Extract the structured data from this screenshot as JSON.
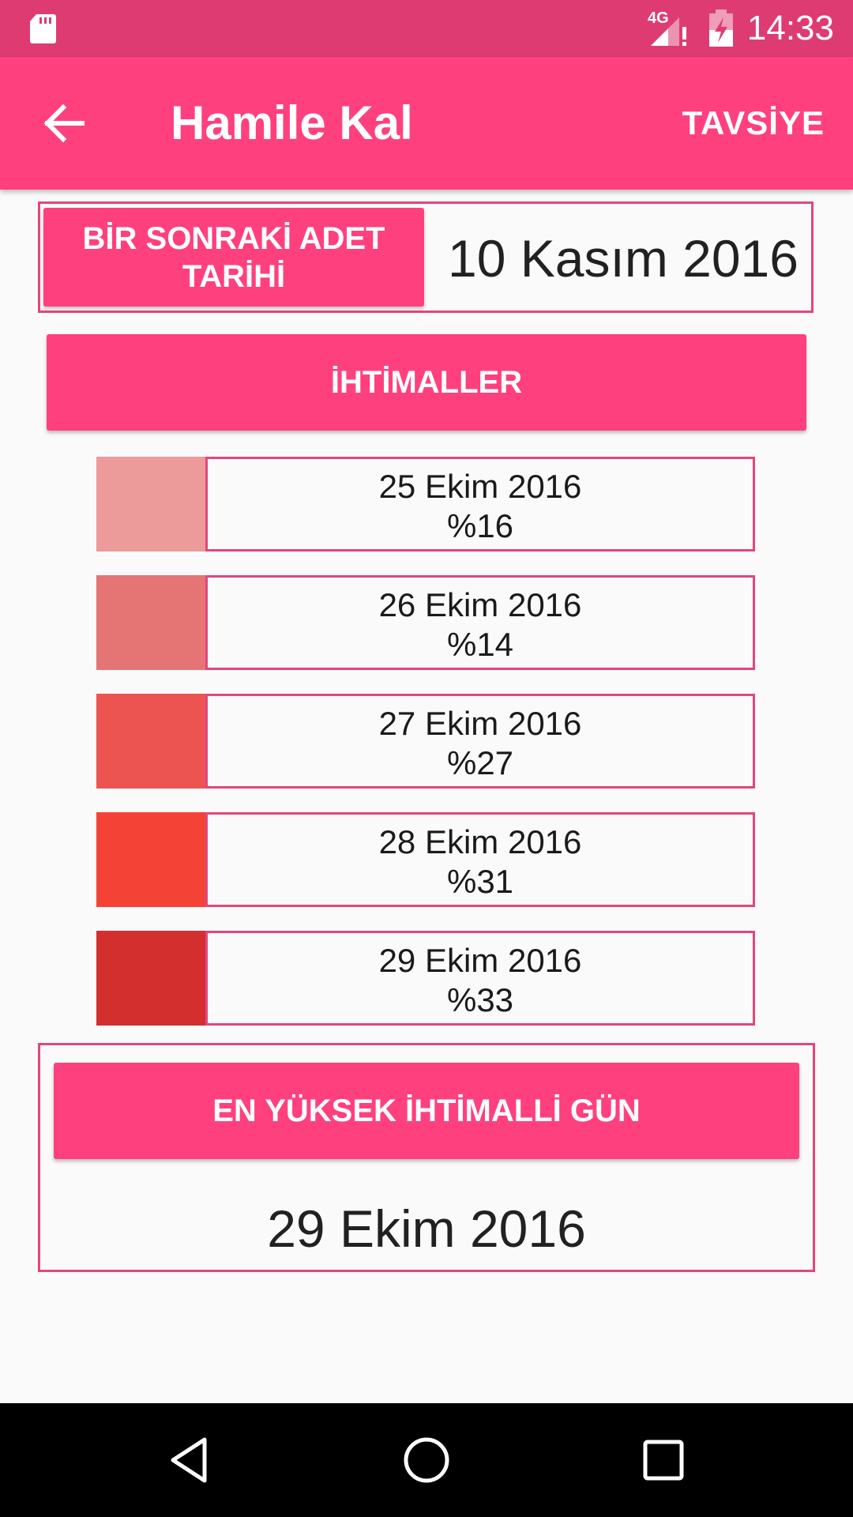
{
  "status_bar": {
    "time": "14:33",
    "network_label": "4G",
    "icons": [
      "sd-card-icon",
      "signal-icon",
      "battery-charging-icon"
    ]
  },
  "toolbar": {
    "title": "Hamile Kal",
    "action_label": "TAVSİYE",
    "back_icon": "arrow-back-icon"
  },
  "next_period": {
    "button_label": "BİR SONRAKİ ADET TARİHİ",
    "date": "10 Kasım 2016"
  },
  "probabilities_button_label": "İHTİMALLER",
  "days": [
    {
      "date": "25 Ekim 2016",
      "percent": "%16",
      "color": "#ed9a9a"
    },
    {
      "date": "26 Ekim 2016",
      "percent": "%14",
      "color": "#e57474"
    },
    {
      "date": "27 Ekim 2016",
      "percent": "%27",
      "color": "#ec5452"
    },
    {
      "date": "28 Ekim 2016",
      "percent": "%31",
      "color": "#f44336"
    },
    {
      "date": "29 Ekim 2016",
      "percent": "%33",
      "color": "#d32f2f"
    }
  ],
  "highest": {
    "button_label": "EN YÜKSEK İHTİMALLİ GÜN",
    "date": "29 Ekim 2016"
  },
  "nav_bar": {
    "icons": [
      "back-triangle-icon",
      "home-circle-icon",
      "recents-square-icon"
    ]
  },
  "colors": {
    "status_bar": "#de3b73",
    "primary": "#ff407e",
    "border": "#e2467c",
    "background": "#fafafa"
  }
}
